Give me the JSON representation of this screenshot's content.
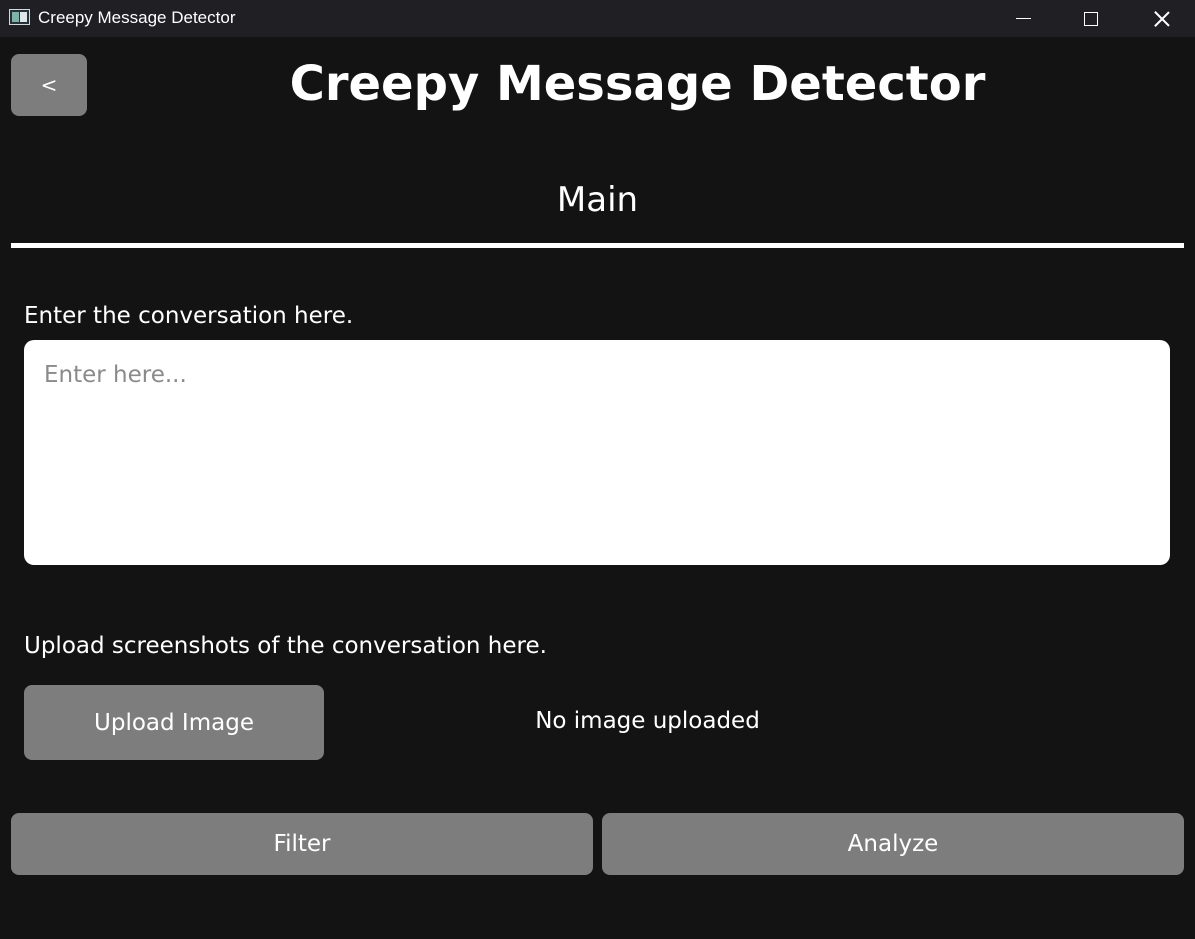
{
  "window": {
    "title": "Creepy Message Detector",
    "controls": [
      "minimize-icon",
      "maximize-icon",
      "close-icon"
    ]
  },
  "header": {
    "back_label": "<",
    "app_title": "Creepy Message Detector",
    "page_title": "Main"
  },
  "conversation": {
    "label": "Enter the conversation here.",
    "placeholder": "Enter here...",
    "value": ""
  },
  "upload": {
    "label": "Upload screenshots of the conversation here.",
    "button_label": "Upload Image",
    "status": "No image uploaded"
  },
  "actions": {
    "filter_label": "Filter",
    "analyze_label": "Analyze"
  },
  "colors": {
    "background": "#131313",
    "titlebar": "#1f1f24",
    "button": "#7d7d7d",
    "text": "#ffffff",
    "input_bg": "#ffffff",
    "placeholder": "#8a8a8a"
  }
}
